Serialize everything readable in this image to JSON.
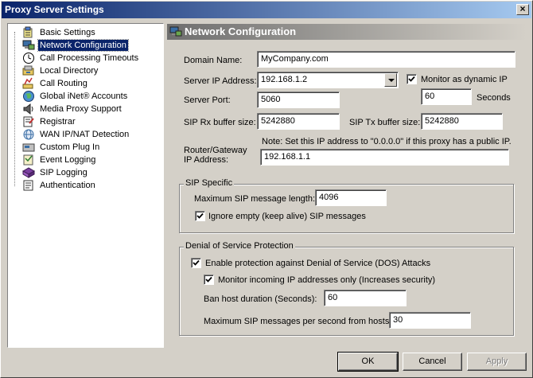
{
  "window": {
    "title": "Proxy Server Settings",
    "close_glyph": "×"
  },
  "tree": {
    "items": [
      {
        "label": "Basic Settings",
        "icon": "settings-icon"
      },
      {
        "label": "Network Configuration",
        "icon": "network-icon",
        "selected": true
      },
      {
        "label": "Call Processing Timeouts",
        "icon": "clock-icon"
      },
      {
        "label": "Local Directory",
        "icon": "directory-icon"
      },
      {
        "label": "Call Routing",
        "icon": "routing-icon"
      },
      {
        "label": "Global iNet® Accounts",
        "icon": "globe-icon"
      },
      {
        "label": "Media Proxy Support",
        "icon": "speaker-icon"
      },
      {
        "label": "Registrar",
        "icon": "registrar-icon"
      },
      {
        "label": "WAN IP/NAT Detection",
        "icon": "wan-icon"
      },
      {
        "label": "Custom Plug In",
        "icon": "plugin-icon"
      },
      {
        "label": "Event Logging",
        "icon": "event-log-icon"
      },
      {
        "label": "SIP Logging",
        "icon": "sip-log-icon"
      },
      {
        "label": "Authentication",
        "icon": "authentication-icon"
      }
    ]
  },
  "section": {
    "title": "Network Configuration",
    "icon": "network-icon"
  },
  "network": {
    "domain_label": "Domain Name:",
    "domain_value": "MyCompany.com",
    "server_ip_label": "Server IP Address:",
    "server_ip_value": "192.168.1.2",
    "monitor_dynamic_label": "Monitor as dynamic IP",
    "monitor_dynamic_checked": true,
    "monitor_seconds_value": "60",
    "seconds_label": "Seconds",
    "server_port_label": "Server Port:",
    "server_port_value": "5060",
    "rx_label": "SIP Rx buffer size:",
    "rx_value": "5242880",
    "tx_label": "SIP Tx buffer size:",
    "tx_value": "5242880",
    "router_label_1": "Router/Gateway",
    "router_label_2": "IP Address:",
    "router_note": "Note: Set this IP address to \"0.0.0.0\" if this proxy has a public IP.",
    "router_value": "192.168.1.1"
  },
  "sip_specific": {
    "title": "SIP Specific",
    "max_len_label": "Maximum SIP message length:",
    "max_len_value": "4096",
    "ignore_empty_label": "Ignore empty (keep alive) SIP messages",
    "ignore_empty_checked": true
  },
  "dos": {
    "title": "Denial of Service Protection",
    "enable_label": "Enable protection against Denial of Service (DOS) Attacks",
    "enable_checked": true,
    "monitor_label": "Monitor incoming IP addresses only (Increases security)",
    "monitor_checked": true,
    "ban_label": "Ban host duration (Seconds):",
    "ban_value": "60",
    "max_msgs_label": "Maximum SIP messages per second from hosts:",
    "max_msgs_value": "30"
  },
  "buttons": {
    "ok": "OK",
    "cancel": "Cancel",
    "apply": "Apply"
  }
}
